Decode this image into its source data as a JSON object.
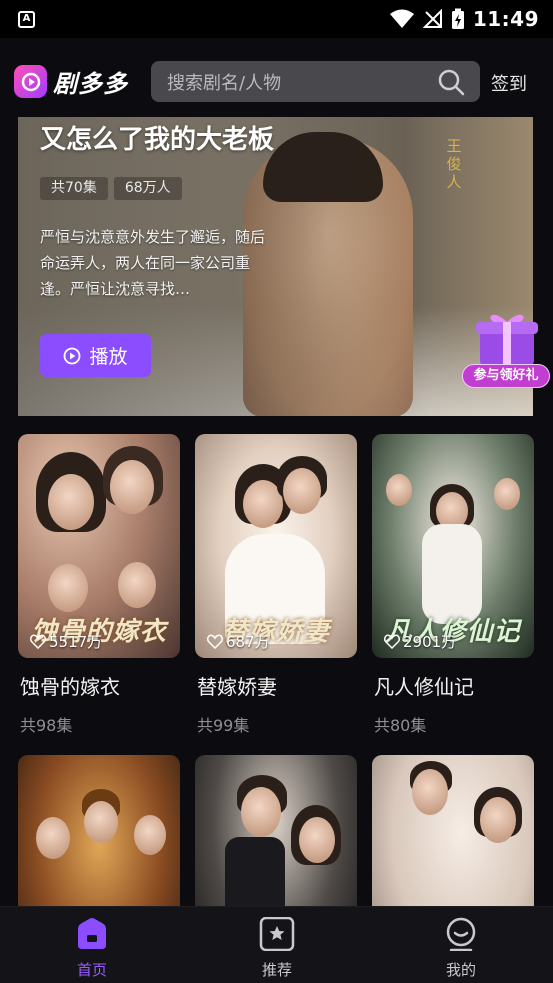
{
  "status_bar": {
    "time": "11:49",
    "app_badge": "A"
  },
  "header": {
    "app_name": "剧多多",
    "search_placeholder": "搜索剧名/人物",
    "signin_label": "签到"
  },
  "hero": {
    "title": "又怎么了我的大老板",
    "tags": [
      "共70集",
      "68万人"
    ],
    "description": "严恒与沈意意外发生了邂逅，随后命运弄人，两人在同一家公司重逢。严恒让沈意寻找…",
    "play_label": "播放",
    "poster_text": "王俊人"
  },
  "gift": {
    "label": "参与领好礼"
  },
  "dramas": [
    {
      "title": "蚀骨的嫁衣",
      "episodes": "共98集",
      "views": "5517万",
      "art_title": "蚀骨的嫁衣"
    },
    {
      "title": "替嫁娇妻",
      "episodes": "共99集",
      "views": "687万",
      "art_title": "替嫁娇妻"
    },
    {
      "title": "凡人修仙记",
      "episodes": "共80集",
      "views": "2901万",
      "art_title": "凡人修仙记"
    },
    {
      "title": "",
      "episodes": "",
      "views": "",
      "art_title": ""
    },
    {
      "title": "",
      "episodes": "",
      "views": "",
      "art_title": ""
    },
    {
      "title": "",
      "episodes": "",
      "views": "",
      "art_title": ""
    }
  ],
  "nav": {
    "items": [
      {
        "label": "首页",
        "icon": "home-icon",
        "active": true
      },
      {
        "label": "推荐",
        "icon": "star-icon",
        "active": false
      },
      {
        "label": "我的",
        "icon": "profile-icon",
        "active": false
      }
    ]
  },
  "colors": {
    "accent": "#8b4dff",
    "active_nav": "#9b5bff",
    "background": "#0c0c10",
    "gift_badge": "#c23ed1"
  }
}
